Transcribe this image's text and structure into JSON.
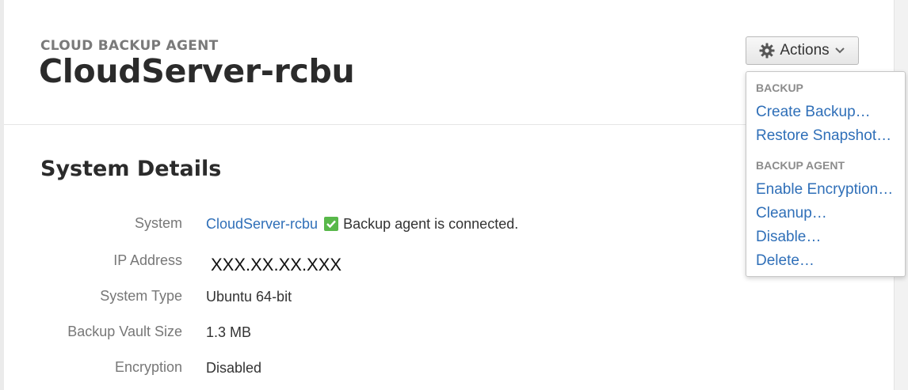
{
  "header": {
    "eyebrow": "CLOUD BACKUP AGENT",
    "title": "CloudServer-rcbu",
    "actions_label": "Actions"
  },
  "details": {
    "title": "System Details",
    "rows": [
      {
        "label": "System",
        "value": "CloudServer-rcbu",
        "status_text": "Backup agent is connected."
      },
      {
        "label": "IP Address",
        "value": "XXX.XX.XX.XXX"
      },
      {
        "label": "System Type",
        "value": "Ubuntu 64-bit"
      },
      {
        "label": "Backup Vault Size",
        "value": "1.3 MB"
      },
      {
        "label": "Encryption",
        "value": "Disabled"
      }
    ]
  },
  "actions_menu": {
    "sections": [
      {
        "header": "BACKUP",
        "items": [
          "Create Backup…",
          "Restore Snapshot…"
        ]
      },
      {
        "header": "BACKUP AGENT",
        "items": [
          "Enable Encryption…",
          "Cleanup…",
          "Disable…",
          "Delete…"
        ]
      }
    ]
  },
  "colors": {
    "link": "#2f6fb8",
    "success": "#58b84a",
    "label_gray": "#777777"
  },
  "icons": {
    "actions": "gear-icon",
    "actions_caret": "chevron-down-icon",
    "status": "check-icon"
  }
}
